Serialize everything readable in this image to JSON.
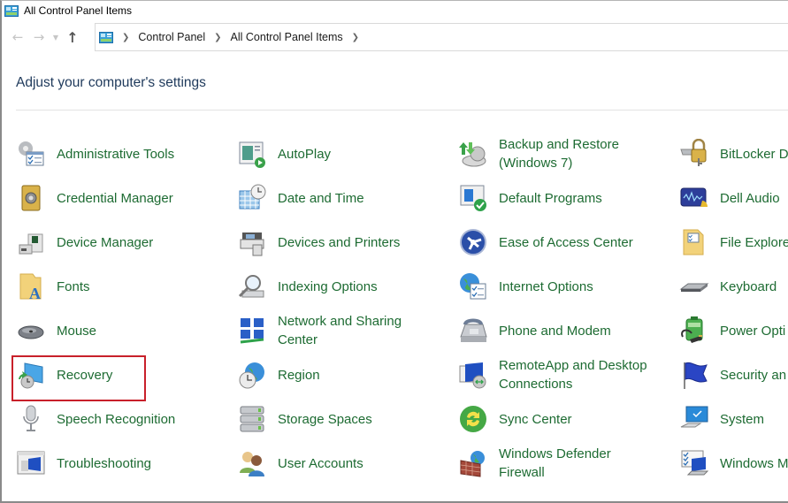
{
  "window": {
    "title": "All Control Panel Items",
    "title_icon": "control-panel-icon"
  },
  "navigation": {
    "back_icon": "back-arrow-icon",
    "forward_icon": "forward-arrow-icon",
    "recent_icon": "chevron-down-icon",
    "up_icon": "up-arrow-icon",
    "breadcrumb": [
      "Control Panel",
      "All Control Panel Items"
    ]
  },
  "main": {
    "heading": "Adjust your computer's settings",
    "highlighted_item": "Recovery",
    "highlight_color": "#c8202a",
    "link_color": "#1d6b32",
    "columns": [
      [
        {
          "label": "Administrative Tools",
          "icon": "administrative-tools-icon"
        },
        {
          "label": "Credential Manager",
          "icon": "credential-manager-icon"
        },
        {
          "label": "Device Manager",
          "icon": "device-manager-icon"
        },
        {
          "label": "Fonts",
          "icon": "fonts-icon"
        },
        {
          "label": "Mouse",
          "icon": "mouse-icon"
        },
        {
          "label": "Recovery",
          "icon": "recovery-icon"
        },
        {
          "label": "Speech Recognition",
          "icon": "microphone-icon"
        },
        {
          "label": "Troubleshooting",
          "icon": "troubleshooting-icon"
        }
      ],
      [
        {
          "label": "AutoPlay",
          "icon": "autoplay-icon"
        },
        {
          "label": "Date and Time",
          "icon": "date-time-icon"
        },
        {
          "label": "Devices and Printers",
          "icon": "printer-icon"
        },
        {
          "label": "Indexing Options",
          "icon": "indexing-icon"
        },
        {
          "label": "Network and Sharing Center",
          "icon": "network-icon"
        },
        {
          "label": "Region",
          "icon": "region-globe-icon"
        },
        {
          "label": "Storage Spaces",
          "icon": "storage-spaces-icon"
        },
        {
          "label": "User Accounts",
          "icon": "user-accounts-icon"
        }
      ],
      [
        {
          "label": "Backup and Restore (Windows 7)",
          "icon": "backup-restore-icon"
        },
        {
          "label": "Default Programs",
          "icon": "default-programs-icon"
        },
        {
          "label": "Ease of Access Center",
          "icon": "ease-of-access-icon"
        },
        {
          "label": "Internet Options",
          "icon": "internet-options-icon"
        },
        {
          "label": "Phone and Modem",
          "icon": "phone-modem-icon"
        },
        {
          "label": "RemoteApp and Desktop Connections",
          "icon": "remoteapp-icon"
        },
        {
          "label": "Sync Center",
          "icon": "sync-center-icon"
        },
        {
          "label": "Windows Defender Firewall",
          "icon": "firewall-icon"
        }
      ],
      [
        {
          "label": "BitLocker D",
          "icon": "bitlocker-lock-icon"
        },
        {
          "label": "Dell Audio",
          "icon": "dell-audio-icon"
        },
        {
          "label": "File Explore",
          "icon": "file-explorer-options-icon"
        },
        {
          "label": "Keyboard",
          "icon": "keyboard-icon"
        },
        {
          "label": "Power Opti",
          "icon": "power-options-icon"
        },
        {
          "label": "Security an",
          "icon": "security-flag-icon"
        },
        {
          "label": "System",
          "icon": "system-monitor-icon"
        },
        {
          "label": "Windows M",
          "icon": "windows-mobility-icon"
        }
      ]
    ]
  }
}
